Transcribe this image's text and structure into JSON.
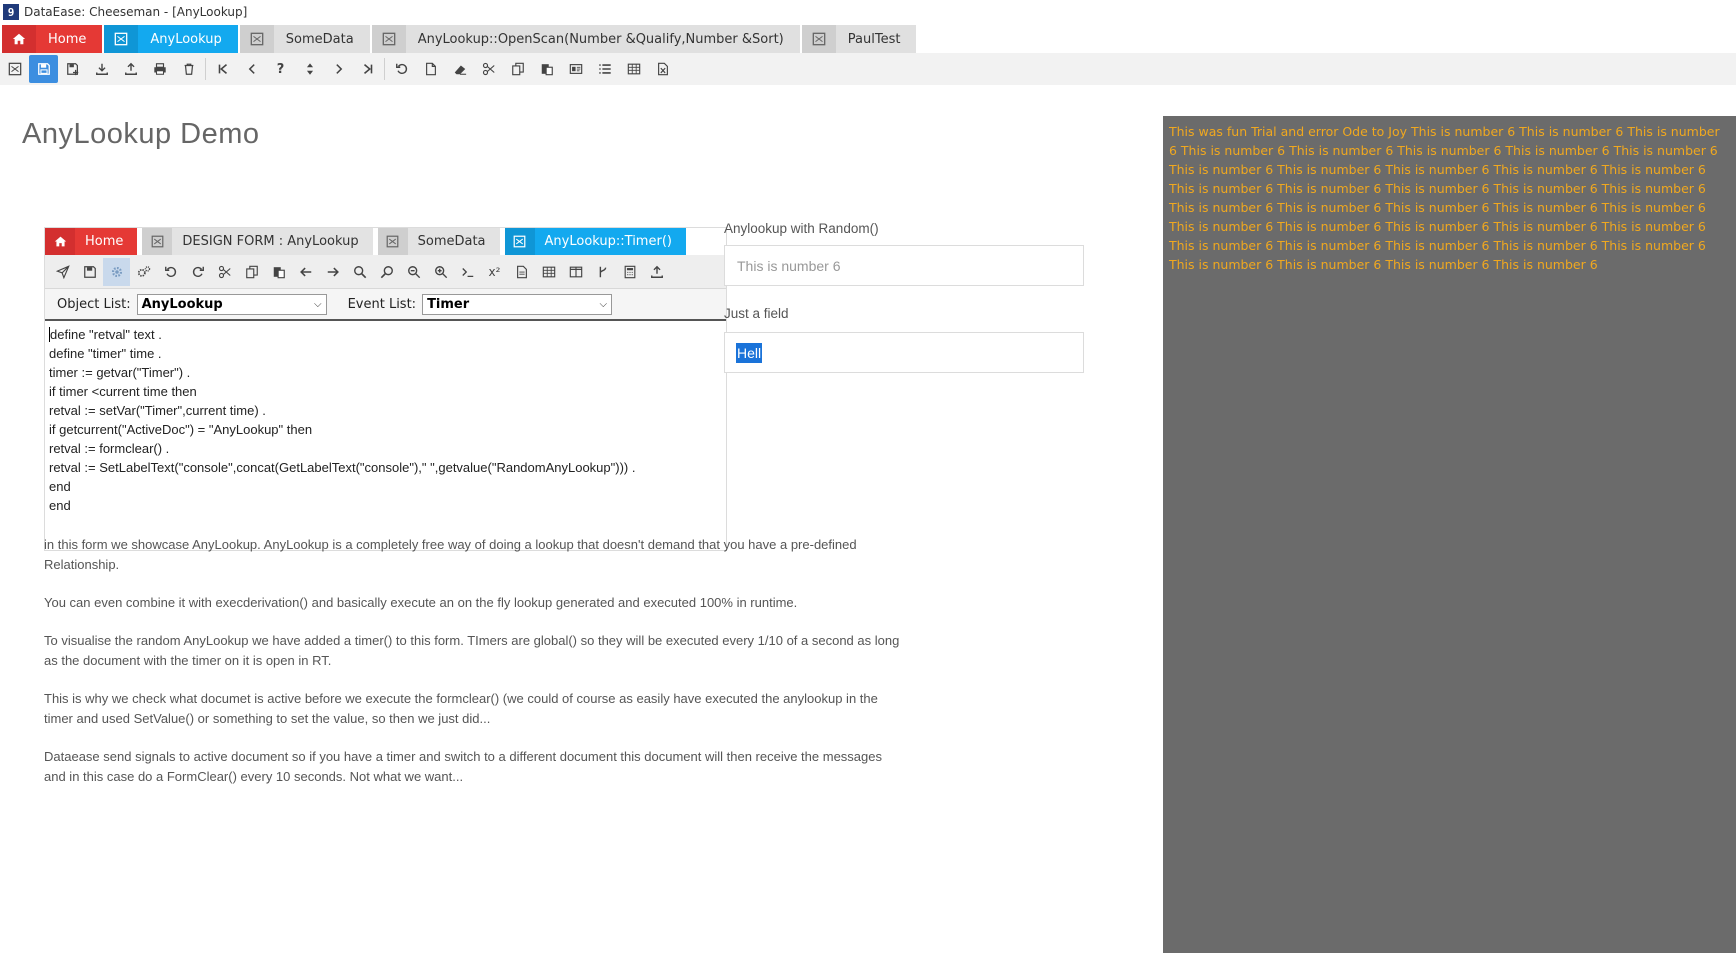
{
  "window": {
    "title": "DataEase: Cheeseman - [AnyLookup]",
    "app_icon_glyph": "9"
  },
  "main_tabs": [
    {
      "label": "Home",
      "icon": "home-icon",
      "style": "red"
    },
    {
      "label": "AnyLookup",
      "icon": "form-icon",
      "style": "blue"
    },
    {
      "label": "SomeData",
      "icon": "form-icon",
      "style": "gray"
    },
    {
      "label": "AnyLookup::OpenScan(Number &Qualify,Number &Sort)",
      "icon": "form-icon",
      "style": "gray"
    },
    {
      "label": "PaulTest",
      "icon": "form-icon",
      "style": "gray"
    }
  ],
  "page": {
    "title": "AnyLookup Demo"
  },
  "designer": {
    "tabs": [
      {
        "label": "Home",
        "style": "red"
      },
      {
        "label": "DESIGN FORM : AnyLookup",
        "style": "gray"
      },
      {
        "label": "SomeData",
        "style": "gray"
      },
      {
        "label": "AnyLookup::Timer()",
        "style": "blue"
      }
    ],
    "object_list_label": "Object List:",
    "object_list_value": "AnyLookup",
    "event_list_label": "Event List:",
    "event_list_value": "Timer",
    "code_lines": [
      "define \"retval\" text .",
      "define \"timer\" time .",
      "timer := getvar(\"Timer\") .",
      "if timer <current time then",
      "retval := setVar(\"Timer\",current time) .",
      "if getcurrent(\"ActiveDoc\") = \"AnyLookup\" then",
      "retval := formclear() .",
      "retval := SetLabelText(\"console\",concat(GetLabelText(\"console\"),\" \",getvalue(\"RandomAnyLookup\"))) .",
      "end",
      "end"
    ]
  },
  "description": [
    "in this form we showcase AnyLookup. AnyLookup is a completely free way of doing a lookup that doesn't demand that you have a pre-defined Relationship.",
    "You can even combine it with execderivation() and basically execute an on the fly lookup generated and executed 100% in runtime.",
    "To visualise the random AnyLookup we have added a timer() to this form. TImers are global() so they will be executed every 1/10 of a second as long as the document with the timer on it is open in RT.",
    "This is why we check what documet is active before we execute the formclear() (we could of course as easily have executed the anylookup in the timer and used SetValue() or something to set the value, so then we just did...",
    "Dataease send signals to active document so if you have a timer and switch to a different document this document will then receive the messages and in this case do a FormClear() every 10 seconds. Not what we want..."
  ],
  "fields": {
    "random_label": "Anylookup with Random()",
    "random_value": "This is number 6",
    "just_label": "Just a field",
    "just_value": "Hell"
  },
  "console": {
    "text": "This was fun Trial and error Ode to Joy This is number 6 This is number 6 This is number 6 This is number 6 This is number 6 This is number 6 This is number 6 This is number 6 This is number 6 This is number 6 This is number 6 This is number 6 This is number 6 This is number 6 This is number 6 This is number 6 This is number 6 This is number 6 This is number 6 This is number 6 This is number 6 This is number 6 This is number 6 This is number 6 This is number 6 This is number 6 This is number 6 This is number 6 This is number 6 This is number 6 This is number 6 This is number 6 This is number 6 This is number 6 This is number 6 This is number 6 This is number 6",
    "bg_color": "#6b6b6b",
    "text_color": "#f0a81f"
  },
  "colors": {
    "home_tab": "#e53935",
    "active_tab": "#13a9ef",
    "toolbar_active": "#3c8ee0"
  }
}
